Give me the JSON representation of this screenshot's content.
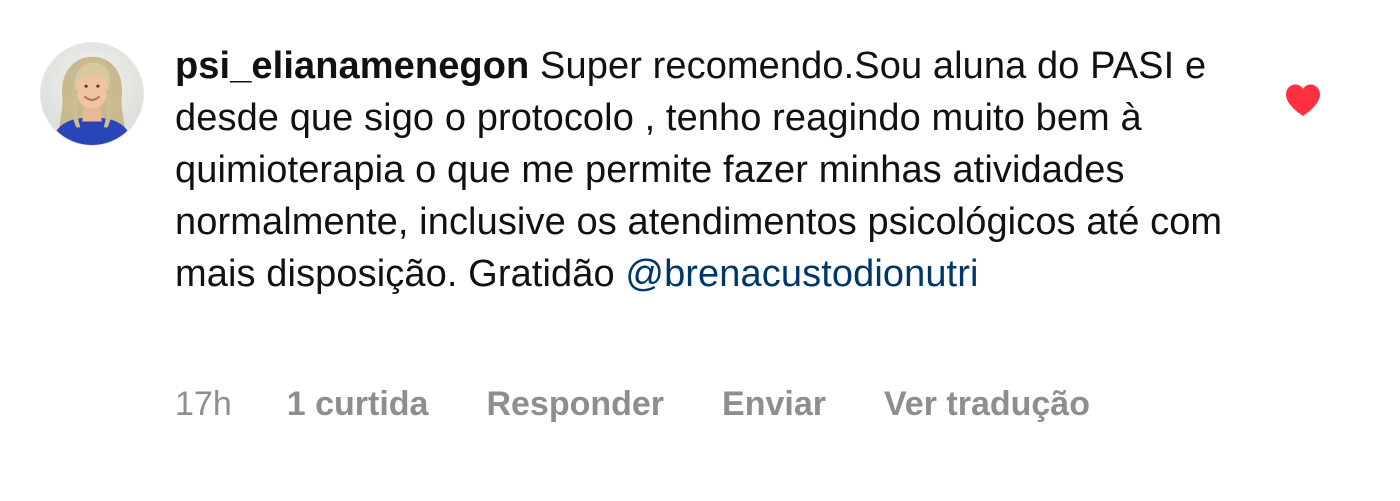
{
  "comment": {
    "username": "psi_elianamenegon",
    "text": "Super recomendo.Sou aluna do PASI e desde que sigo o protocolo , tenho reagindo muito bem à quimioterapia o que me permite fazer minhas atividades normalmente, inclusive os atendimentos psicológicos até com mais disposição. Gratidão",
    "mention": "@brenacustodionutri",
    "liked": true,
    "heart_color": "#ff3040",
    "mention_color": "#00376b",
    "meta_color": "#8e8e8e"
  },
  "meta": {
    "time": "17h",
    "likes": "1 curtida",
    "reply": "Responder",
    "send": "Enviar",
    "translate": "Ver tradução"
  },
  "icons": {
    "avatar": "profile-photo",
    "like": "heart-filled-icon"
  }
}
